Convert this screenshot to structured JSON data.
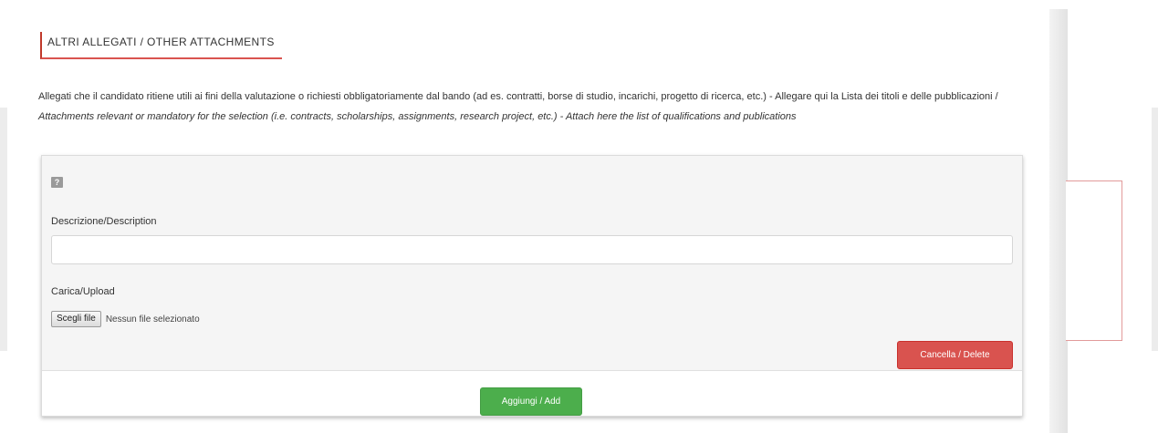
{
  "section": {
    "title": "ALTRI ALLEGATI / OTHER ATTACHMENTS"
  },
  "intro": {
    "line_it": "Allegati che il candidato ritiene utili ai fini della valutazione o richiesti obbligatoriamente dal bando (ad es. contratti, borse di studio, incarichi, progetto di ricerca, etc.) - Allegare qui la Lista dei titoli e delle pubblicazioni / ",
    "line_en": "Attachments relevant or mandatory for the selection (i.e. contracts, scholarships, assignments, research project, etc.) - Attach here the list of qualifications and publications"
  },
  "form": {
    "help_icon": "?",
    "description_label": "Descrizione/Description",
    "description_value": "",
    "upload_label": "Carica/Upload",
    "file_button_label": "Scegli file",
    "file_status": "Nessun file selezionato",
    "delete_label": "Cancella / Delete"
  },
  "actions": {
    "add_label": "Aggiungi / Add"
  },
  "colors": {
    "accent_red": "#d9534f",
    "success_green": "#4cae4c"
  },
  "icons": {
    "help": "help-icon"
  }
}
